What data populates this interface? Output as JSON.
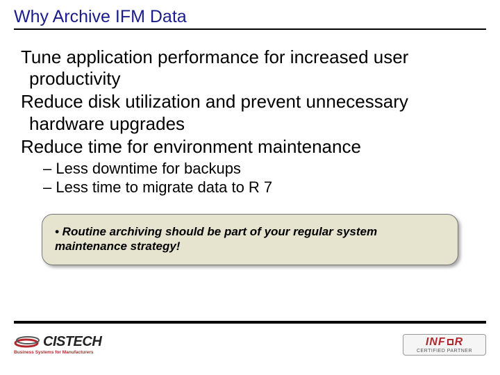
{
  "title": "Why Archive IFM Data",
  "points": [
    "Tune application performance for increased user productivity",
    "Reduce disk utilization and prevent unnecessary hardware upgrades",
    "Reduce time for environment maintenance"
  ],
  "subpoints": [
    "– Less downtime for backups",
    "– Less time to migrate data to R 7"
  ],
  "callout": "• Routine archiving should be part of your regular system maintenance strategy!",
  "footer": {
    "cistech": {
      "name": "CISTECH",
      "tag": "Business Systems for Manufacturers"
    },
    "infor": {
      "name": "INF   R",
      "sub": "CERTIFIED PARTNER"
    }
  }
}
